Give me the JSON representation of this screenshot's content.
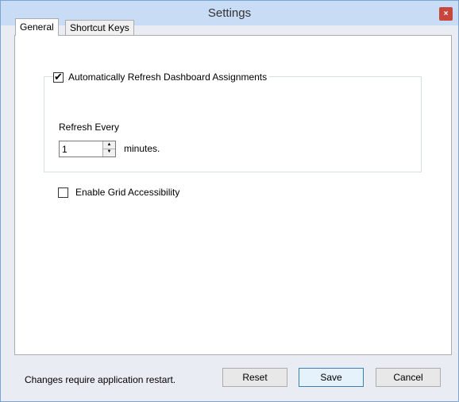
{
  "window": {
    "title": "Settings",
    "close_glyph": "×",
    "colors": {
      "titlebar": "#c9dcf5",
      "close": "#c8473c",
      "frame": "#e9edf3"
    }
  },
  "tabs": [
    {
      "label": "General",
      "active": true
    },
    {
      "label": "Shortcut Keys",
      "active": false
    }
  ],
  "general": {
    "auto_refresh": {
      "label": "Automatically Refresh Dashboard Assignments",
      "checked": true
    },
    "refresh_every_label": "Refresh Every",
    "refresh_value": "1",
    "minutes_label": "minutes.",
    "grid_accessibility": {
      "label": "Enable Grid Accessibility",
      "checked": false
    }
  },
  "footer": {
    "note": "Changes require application restart.",
    "reset_label": "Reset",
    "save_label": "Save",
    "cancel_label": "Cancel"
  }
}
